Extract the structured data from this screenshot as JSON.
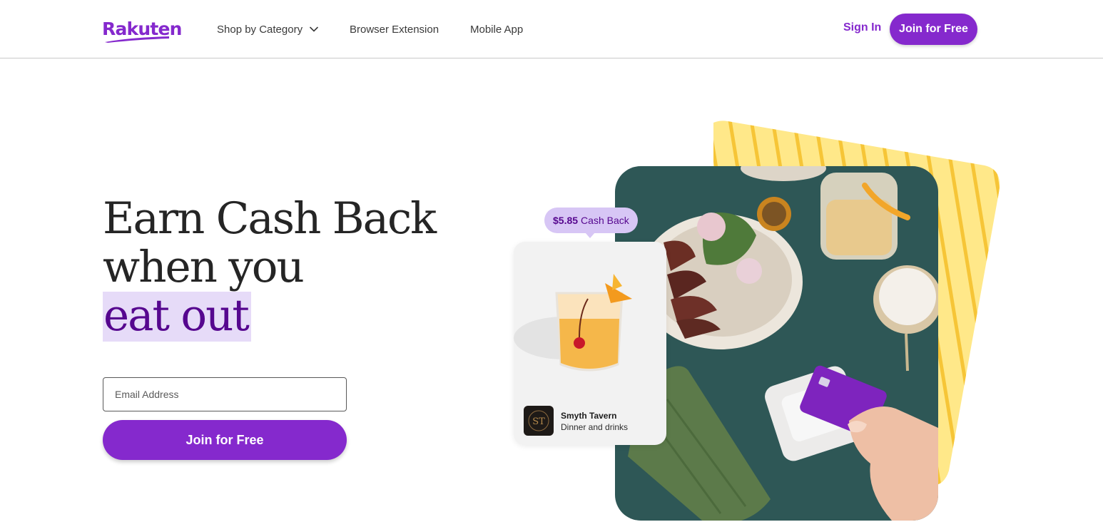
{
  "header": {
    "logo_text": "Rakuten",
    "nav": {
      "shop_by_category": "Shop by Category",
      "browser_extension": "Browser Extension",
      "mobile_app": "Mobile App"
    },
    "sign_in": "Sign In",
    "join_label": "Join for Free"
  },
  "hero": {
    "headline_line1": "Earn Cash Back",
    "headline_line2": "when you",
    "headline_highlight": "eat out",
    "email_placeholder": "Email Address",
    "join_label": "Join for Free"
  },
  "promo": {
    "cash_back_amount": "$5.85",
    "cash_back_label": "Cash Back",
    "merchant_name": "Smyth Tavern",
    "merchant_description": "Dinner and drinks",
    "merchant_logo_text": "ST"
  },
  "colors": {
    "brand_purple": "#8529cd",
    "highlight_bg": "#e6dbf8",
    "highlight_text": "#56078f",
    "accent_yellow": "#ffdf6b",
    "table_teal": "#2e5756"
  },
  "icons": {
    "dropdown": "chevron-down-icon",
    "logo": "rakuten-logo"
  }
}
